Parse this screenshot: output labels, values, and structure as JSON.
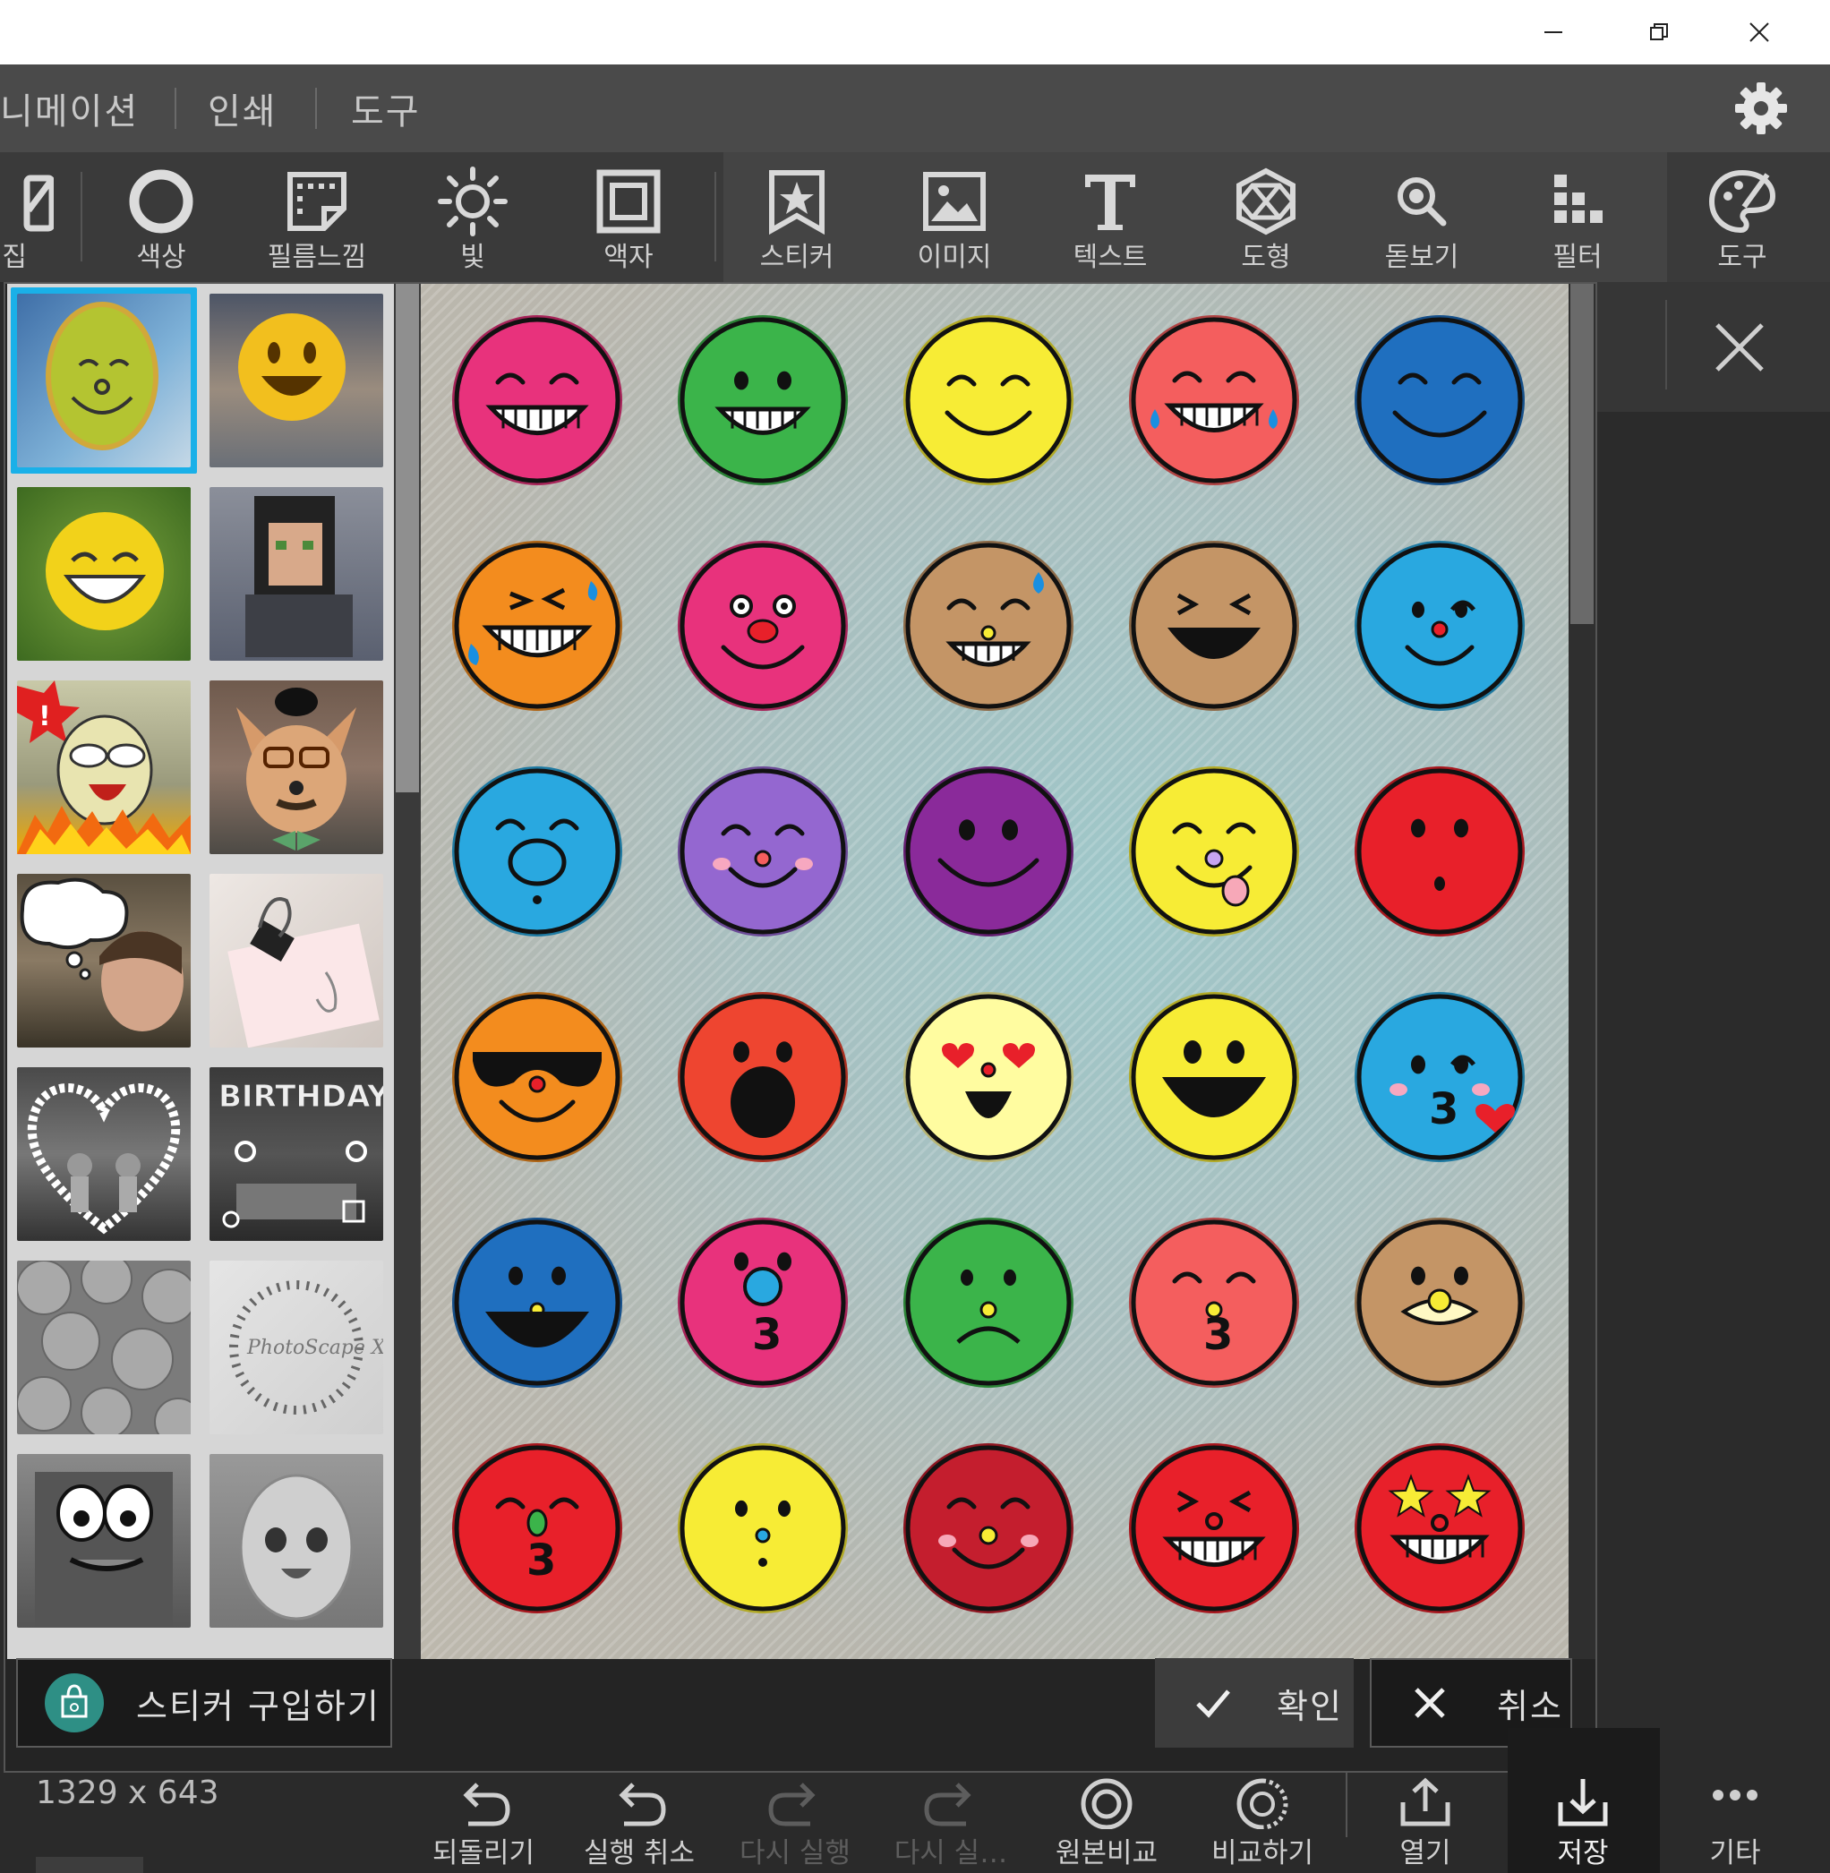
{
  "window": {
    "minimize_icon": "minimize-icon",
    "restore_icon": "restore-icon",
    "close_icon": "close-icon"
  },
  "menu": {
    "items": [
      "니메이션",
      "인쇄",
      "도구"
    ],
    "settings_icon": "gear-icon"
  },
  "toolbar": {
    "tools": [
      {
        "label": "집",
        "icon": "edit-icon"
      },
      {
        "label": "색상",
        "icon": "circle-icon"
      },
      {
        "label": "필름느낌",
        "icon": "film-icon"
      },
      {
        "label": "빛",
        "icon": "sun-icon"
      },
      {
        "label": "액자",
        "icon": "frame-icon"
      },
      {
        "label": "스티커",
        "icon": "sticker-icon"
      },
      {
        "label": "이미지",
        "icon": "image-icon"
      },
      {
        "label": "텍스트",
        "icon": "text-icon"
      },
      {
        "label": "도형",
        "icon": "shape-icon"
      },
      {
        "label": "돋보기",
        "icon": "magnifier-icon"
      },
      {
        "label": "필터",
        "icon": "filter-icon"
      },
      {
        "label": "도구",
        "icon": "palette-icon"
      }
    ]
  },
  "dialog": {
    "buy_label": "스티커 구입하기",
    "ok_label": "확인",
    "cancel_label": "취소",
    "stickers": [
      {
        "color": "#e8327c",
        "face": "grin"
      },
      {
        "color": "#3bb44a",
        "face": "open-smile"
      },
      {
        "color": "#f7ec35",
        "face": "calm-smile"
      },
      {
        "color": "#f45e5e",
        "face": "tears-laugh"
      },
      {
        "color": "#1f6fbf",
        "face": "calm-closed"
      },
      {
        "color": "#f38c1e",
        "face": "rofl"
      },
      {
        "color": "#e8327c",
        "face": "clown"
      },
      {
        "color": "#c49566",
        "face": "sweat-grin"
      },
      {
        "color": "#c49566",
        "face": "squint-laugh"
      },
      {
        "color": "#29a8e0",
        "face": "wink"
      },
      {
        "color": "#29a8e0",
        "face": "sleepy-pig"
      },
      {
        "color": "#9467d0",
        "face": "blush"
      },
      {
        "color": "#8a2a9a",
        "face": "smile"
      },
      {
        "color": "#f7ec35",
        "face": "tongue"
      },
      {
        "color": "#e8202a",
        "face": "surprised"
      },
      {
        "color": "#f38c1e",
        "face": "sunglasses"
      },
      {
        "color": "#ee4530",
        "face": "shocked"
      },
      {
        "color": "#fffca0",
        "face": "heart-eyes"
      },
      {
        "color": "#f7ec35",
        "face": "big-smile"
      },
      {
        "color": "#29a8e0",
        "face": "kiss-heart"
      },
      {
        "color": "#1f6fbf",
        "face": "laugh"
      },
      {
        "color": "#e8327c",
        "face": "kiss-nose"
      },
      {
        "color": "#3bb44a",
        "face": "sad"
      },
      {
        "color": "#f45e5e",
        "face": "kiss-freckle"
      },
      {
        "color": "#c49566",
        "face": "duck"
      },
      {
        "color": "#e8202a",
        "face": "kiss-green"
      },
      {
        "color": "#f7ec35",
        "face": "dots"
      },
      {
        "color": "#c41e2e",
        "face": "blush-smile"
      },
      {
        "color": "#e8202a",
        "face": "squint-grin"
      },
      {
        "color": "#e8202a",
        "face": "star-eyes"
      }
    ]
  },
  "statusbar": {
    "size": "1329 x 643"
  },
  "bottom": {
    "buttons": [
      {
        "label": "되돌리기",
        "icon": "revert-icon"
      },
      {
        "label": "실행 취소",
        "icon": "undo-icon"
      },
      {
        "label": "다시 실행",
        "icon": "redo-icon"
      },
      {
        "label": "다시 실…",
        "icon": "redo-all-icon"
      },
      {
        "label": "원본비교",
        "icon": "compare-original-icon"
      },
      {
        "label": "비교하기",
        "icon": "compare-icon"
      },
      {
        "label": "열기",
        "icon": "open-icon"
      },
      {
        "label": "저장",
        "icon": "save-icon"
      },
      {
        "label": "기타",
        "icon": "more-icon"
      }
    ]
  }
}
